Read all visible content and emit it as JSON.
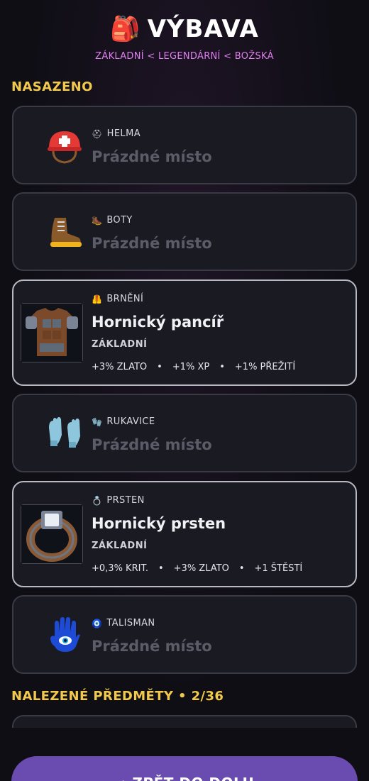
{
  "header": {
    "icon": "backpack-icon",
    "icon_glyph": "🎒",
    "title": "VÝBAVA",
    "rarity_order": "ZÁKLADNÍ < LEGENDÁRNÍ < BOŽSKÁ"
  },
  "equipped_section": {
    "title": "NASAZENO"
  },
  "slots": [
    {
      "label": "HELMA",
      "emoji": "⛑",
      "icon": "helmet-icon",
      "empty_text": "Prázdné místo"
    },
    {
      "label": "BOTY",
      "emoji": "🥾",
      "icon": "boot-icon",
      "empty_text": "Prázdné místo"
    },
    {
      "label": "BRNĚNÍ",
      "emoji": "🦺",
      "icon": "armor-icon",
      "item_name": "Hornický pancíř",
      "tier": "ZÁKLADNÍ",
      "stats": [
        "+3% ZLATO",
        "+1% XP",
        "+1% PŘEŽITÍ"
      ]
    },
    {
      "label": "RUKAVICE",
      "emoji": "🧤",
      "icon": "gloves-icon",
      "empty_text": "Prázdné místo"
    },
    {
      "label": "PRSTEN",
      "emoji": "💍",
      "icon": "ring-icon",
      "item_name": "Hornický prsten",
      "tier": "ZÁKLADNÍ",
      "stats": [
        "+0,3% KRIT.",
        "+3% ZLATO",
        "+1 ŠTĚSTÍ"
      ]
    },
    {
      "label": "TALISMAN",
      "emoji": "🧿",
      "icon": "hamsa-icon",
      "empty_text": "Prázdné místo"
    }
  ],
  "found_section": {
    "title": "NALEZENÉ PŘEDMĚTY • 2/36"
  },
  "cta": {
    "label": "→ ZPĚT DO DOLU"
  },
  "colors": {
    "accent": "#f2c94c",
    "rarity": "#e07ff0",
    "button": "#6a4cb0"
  }
}
